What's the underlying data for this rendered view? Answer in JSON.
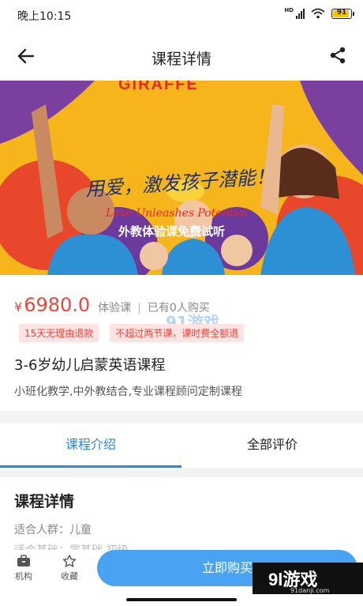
{
  "status_bar": {
    "time": "晚上10:15",
    "network": "HD",
    "battery": "91"
  },
  "header": {
    "title": "课程详情",
    "back_icon": "arrow-left-icon",
    "share_icon": "share-icon"
  },
  "banner": {
    "brand": "GIRAFFE",
    "slogan": "用爱，激发孩子潜能！",
    "slogan_en": "Love Unleashes Potential",
    "promo": "外教体验课免费试听"
  },
  "course": {
    "currency": "¥",
    "price": "6980.0",
    "type": "体验课",
    "sold": "已有0人购买",
    "tags": [
      "15天无理由退款",
      "不超过两节课，课时费全额退"
    ],
    "title": "3-6岁幼儿启蒙英语课程",
    "subtitle": "小班化教学,中外教结合,专业课程顾问定制课程"
  },
  "tabs": [
    {
      "label": "课程介绍",
      "active": true
    },
    {
      "label": "全部评价",
      "active": false
    }
  ],
  "details": {
    "section_title": "课程详情",
    "audience": "适合人群：儿童",
    "partial_line": "适合基础：零基础 初级"
  },
  "bottom_bar": {
    "institution_label": "机构",
    "favorite_label": "收藏",
    "buy_label": "立即购买"
  },
  "watermark": {
    "mid": "91游戏",
    "logo": "9l游戏",
    "url": "91danji.com"
  },
  "colors": {
    "accent": "#2f88d7",
    "price": "#e8463e",
    "buy_button": "#4aa3f2"
  }
}
